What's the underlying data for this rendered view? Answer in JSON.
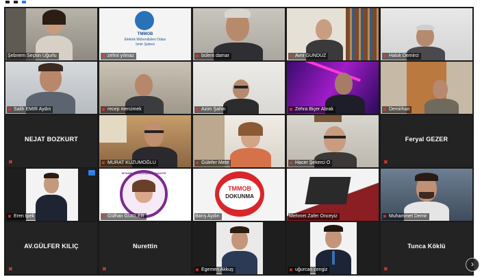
{
  "participants": [
    {
      "name": "Şebnem Seçkin Uğurlu"
    },
    {
      "name": "zehni yılmaz"
    },
    {
      "name": "bülent damar"
    },
    {
      "name": "Avni GÜNDÜZ"
    },
    {
      "name": "Haluk Demirci"
    },
    {
      "name": "Salih EMİR Aydın"
    },
    {
      "name": "recep mercimek"
    },
    {
      "name": "Azim Şahin"
    },
    {
      "name": "Zehra Biçer Abrak"
    },
    {
      "name": "Demirhan"
    },
    {
      "name": "NEJAT BOZKURT"
    },
    {
      "name": "MURAT KUZUMOĞLU"
    },
    {
      "name": "Gülefer Mete"
    },
    {
      "name": "Hacer Şekerci Ö"
    },
    {
      "name": "Feryal GEZER"
    },
    {
      "name": "Eren İpek"
    },
    {
      "name": "Gülhan GÜRLER"
    },
    {
      "name": "Barış Aydın"
    },
    {
      "name": "Mehmet Zafer Önceyiz"
    },
    {
      "name": "Muhammet Demir"
    },
    {
      "name": "AV.GÜLFER KILIÇ"
    },
    {
      "name": "Nurettin"
    },
    {
      "name": "Egemen Akkuş"
    },
    {
      "name": "uğurcan cengiz"
    },
    {
      "name": "Tunca Köklü"
    }
  ],
  "logo_tile": {
    "line1": "TMMOB",
    "line2": "Elektrik Mühendisleri Odası",
    "line3": "İzmir Şubesi"
  },
  "campaign_badge": {
    "top": "TMMOB",
    "bottom": "DOKUNMA"
  },
  "circle_badge": {
    "text": "İSTANBUL SÖZLEŞMESİ YAŞATIR"
  },
  "nav": {
    "next_page": "›"
  },
  "colors": {
    "muted_mic": "#e23a3a",
    "active_border": "#c8d85a",
    "accent": "#2d7be0"
  }
}
